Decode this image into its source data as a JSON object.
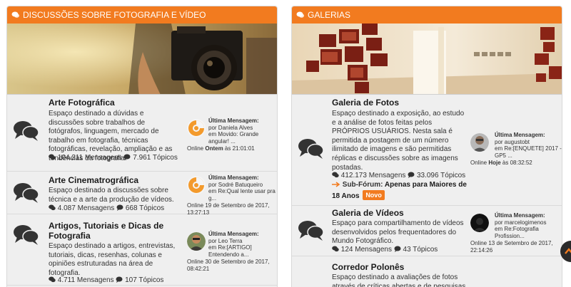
{
  "colors": {
    "accent": "#f27b1f",
    "panel_bg": "#efefef",
    "divider": "#dadada"
  },
  "left": {
    "header_icon": "chat-bubbles-icon",
    "title": "DISCUSSÕES SOBRE FOTOGRAFIA E VÍDEO",
    "forums": [
      {
        "title": "Arte Fotográfica",
        "description": "Espaço destinado a dúvidas e discussões sobre trabalhos de fotógrafos, linguagem, mercado de trabalho em fotografia, técnicas fotográficas, revelação, ampliação e as tendências da fotografia.",
        "messages": "104.211 Mensagens",
        "topics": "7.961 Tópicos",
        "last_label": "Última Mensagem:",
        "last_by": "por Daniela Alves",
        "last_in": "em Movido: Grande angular! ...",
        "last_when": "Online Ontem às 21:01:01",
        "last_when_pre": "Online ",
        "last_when_bold": "Ontem",
        "last_when_post": " às 21:01:01"
      },
      {
        "title": "Arte Cinematrográfica",
        "description": "Espaço destinado a discussões sobre técnica e a arte da produção de vídeos.",
        "messages": "4.087 Mensagens",
        "topics": "668 Tópicos",
        "last_label": "Última Mensagem:",
        "last_by": "por Sodré Batuqueiro",
        "last_in": "em Re:Qual lente usar pra g...",
        "last_when": "Online 19 de Setembro de 2017, 13:27:13"
      },
      {
        "title": "Artigos, Tutoriais e Dicas de Fotografia",
        "description": "Espaço destinado a artigos, entrevistas, tutoriais, dicas, resenhas, colunas e opiniões estruturadas na área de fotografia.",
        "messages": "4.711 Mensagens",
        "topics": "107 Tópicos",
        "last_label": "Última Mensagem:",
        "last_by": "por Leo Terra",
        "last_in": "em Re:[ARTIGO] Entendendo a...",
        "last_when": "Online 30 de Setembro de 2017, 08:42:21"
      }
    ]
  },
  "right": {
    "header_icon": "chat-bubbles-icon",
    "title": "GALERIAS",
    "forums": [
      {
        "title": "Galeria de Fotos",
        "description": "Espaço destinado a exposição, ao estudo e a análise de fotos feitas pelos PRÓPRIOS USUÁRIOS. Nesta sala é permitida a postagem de um número ilimitado de imagens e são permitidas réplicas e discussões sobre as imagens postadas.",
        "messages": "412.173 Mensagens",
        "topics": "33.096 Tópicos",
        "subforum_label": "Sub-Fórum:",
        "subforum_title": "Apenas para Maiores de 18 Anos",
        "subforum_badge": "Novo",
        "last_label": "Última Mensagem:",
        "last_by": "por augustobt",
        "last_in": "em Re:[ENQUETE] 2017 - GP5 ...",
        "last_when": "Online Hoje às 08:32:52",
        "last_when_pre": "Online ",
        "last_when_bold": "Hoje",
        "last_when_post": " às 08:32:52"
      },
      {
        "title": "Galeria de Vídeos",
        "description": "Espaço para compartilhamento de vídeos desenvolvidos pelos frequentadores do Mundo Fotográfico.",
        "messages": "124 Mensagens",
        "topics": "43 Tópicos",
        "last_label": "Última Mensagem:",
        "last_by": "por marcelogimenos",
        "last_in": "em Re:Fotografia Profission...",
        "last_when": "Online 13 de Setembro de 2017, 22:14:26"
      },
      {
        "title": "Corredor Polonês",
        "description": "Espaço destinado a avaliações de fotos através de críticas abertas e de pesquisas"
      }
    ]
  },
  "icons": {
    "forum": "chat-bubbles-icon",
    "messages": "comments-icon",
    "topics": "comment-icon",
    "subforum": "arrow-right-icon",
    "scroll": "arrow-up-icon"
  }
}
